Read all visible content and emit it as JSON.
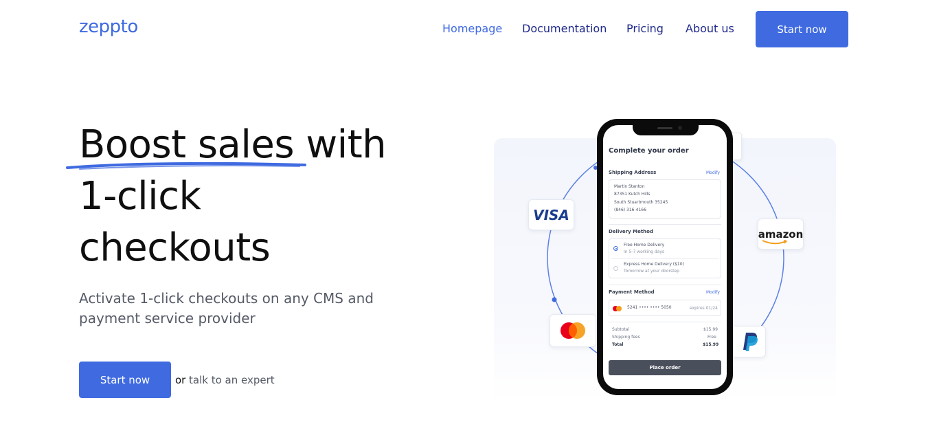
{
  "brand": {
    "logo": "zeppto",
    "accent": "#3f6ae0",
    "nav_text": "#1f2a8a"
  },
  "nav": {
    "items": [
      {
        "label": "Homepage",
        "active": true
      },
      {
        "label": "Documentation",
        "active": false
      },
      {
        "label": "Pricing",
        "active": false
      },
      {
        "label": "About us",
        "active": false
      }
    ],
    "cta": "Start now"
  },
  "hero": {
    "headline_lines": [
      "Boost sales with",
      "1-click",
      "checkouts"
    ],
    "subtitle": "Activate 1-click checkouts on any CMS and payment service provider",
    "cta": "Start now",
    "or_text": "or",
    "talk_link": "talk to an expert"
  },
  "illustration": {
    "badges": {
      "visa": "VISA",
      "amazon": "amazon",
      "mastercard_icon": "mastercard-icon",
      "paypal_icon": "paypal-icon"
    },
    "phone": {
      "title": "Complete your order",
      "shipping": {
        "label": "Shipping Address",
        "modify": "Modify",
        "lines": [
          "Martin Stanton",
          "87351 Kutch Hills",
          "South Stuartmouth 35245",
          "(846) 316-4166"
        ]
      },
      "delivery": {
        "label": "Delivery Method",
        "options": [
          {
            "title": "Free Home Delivery",
            "sub": "In 5-7 working days",
            "selected": true
          },
          {
            "title": "Express Home Delivery ($10)",
            "sub": "Tomorrow at your doorstep",
            "selected": false
          }
        ]
      },
      "payment": {
        "label": "Payment Method",
        "modify": "Modify",
        "card": "5241 •••• •••• 5050",
        "expires": "expires 01/24"
      },
      "totals": {
        "subtotal_label": "Subtotal",
        "subtotal": "$15.99",
        "shipping_label": "Shipping fees",
        "shipping": "Free",
        "total_label": "Total",
        "total": "$15.99"
      },
      "place_order": "Place order"
    }
  }
}
